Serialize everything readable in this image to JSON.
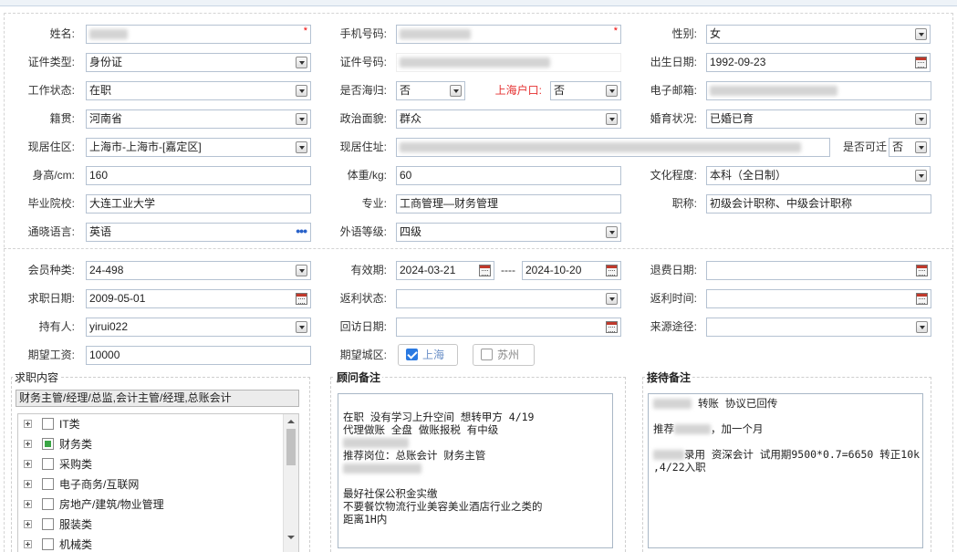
{
  "row1": {
    "name_label": "姓名:",
    "phone_label": "手机号码:",
    "gender_label": "性别:",
    "gender_value": "女",
    "required_mark": "*"
  },
  "row2": {
    "idtype_label": "证件类型:",
    "idtype_value": "身份证",
    "idno_label": "证件号码:",
    "birth_label": "出生日期:",
    "birth_value": "1992-09-23"
  },
  "row3": {
    "work_label": "工作状态:",
    "work_value": "在职",
    "returnee_label": "是否海归:",
    "returnee_value": "否",
    "hukou_label": "上海户口:",
    "hukou_value": "否",
    "email_label": "电子邮箱:"
  },
  "row4": {
    "native_label": "籍贯:",
    "native_value": "河南省",
    "politics_label": "政治面貌:",
    "politics_value": "群众",
    "marital_label": "婚育状况:",
    "marital_value": "已婚已育"
  },
  "row5": {
    "area_label": "现居住区:",
    "area_value": "上海市-上海市-[嘉定区]",
    "addr_label": "现居住址:",
    "relocate_label": "是否可迁",
    "relocate_value": "否"
  },
  "row6": {
    "height_label": "身高/cm:",
    "height_value": "160",
    "weight_label": "体重/kg:",
    "weight_value": "60",
    "edu_label": "文化程度:",
    "edu_value": "本科（全日制）"
  },
  "row7": {
    "school_label": "毕业院校:",
    "school_value": "大连工业大学",
    "major_label": "专业:",
    "major_value": "工商管理—财务管理",
    "title_label": "职称:",
    "title_value": "初级会计职称、中级会计职称"
  },
  "row8": {
    "lang_label": "通晓语言:",
    "lang_value": "英语",
    "lang_more": "•••",
    "level_label": "外语等级:",
    "level_value": "四级"
  },
  "member": {
    "type_label": "会员种类:",
    "type_value": "24-498",
    "valid_label": "有效期:",
    "valid_from": "2024-03-21",
    "valid_sep": "----",
    "valid_to": "2024-10-20",
    "refund_date_label": "退费日期:",
    "job_date_label": "求职日期:",
    "job_date_value": "2009-05-01",
    "rebate_status_label": "返利状态:",
    "rebate_time_label": "返利时间:",
    "holder_label": "持有人:",
    "holder_value": "yirui022",
    "visit_label": "回访日期:",
    "source_label": "来源途径:",
    "salary_label": "期望工资:",
    "salary_value": "10000",
    "city_label": "期望城区:",
    "city_shanghai": "上海",
    "city_shanghai_checked": true,
    "city_suzhou": "苏州",
    "city_suzhou_checked": false
  },
  "job_content": {
    "title": "求职内容",
    "selected": "财务主管/经理/总监,会计主管/经理,总账会计",
    "tree": [
      {
        "label": "IT类",
        "state": "unchecked"
      },
      {
        "label": "财务类",
        "state": "partial"
      },
      {
        "label": "采购类",
        "state": "unchecked"
      },
      {
        "label": "电子商务/互联网",
        "state": "unchecked"
      },
      {
        "label": "房地产/建筑/物业管理",
        "state": "unchecked"
      },
      {
        "label": "服装类",
        "state": "unchecked"
      },
      {
        "label": "机械类",
        "state": "unchecked"
      }
    ]
  },
  "consultant_note": {
    "title": "顾问备注",
    "lines": [
      "在职  没有学习上升空间 想转甲方 4/19",
      "代理做账 全盘 做账报税 有中级",
      "推荐岗位：总账会计 财务主管",
      "最好社保公积金实缴",
      "不要餐饮物流行业美容美业酒店行业之类的",
      "距离1H内"
    ]
  },
  "reception_note": {
    "title": "接待备注",
    "line1": "转账 协议已回传",
    "line2_prefix": "推荐",
    "line2_suffix": "，加一个月",
    "line3": "录用  资深会计 试用期9500*0.7=6650 转正10k",
    "line4": ",4/22入职"
  },
  "colors": {
    "field_border": "#b5c2d2",
    "required": "#e00000",
    "hukou_label": "#e53030",
    "checkbox_accent": "#2a7ae2",
    "tree_partial": "#3aa645"
  }
}
